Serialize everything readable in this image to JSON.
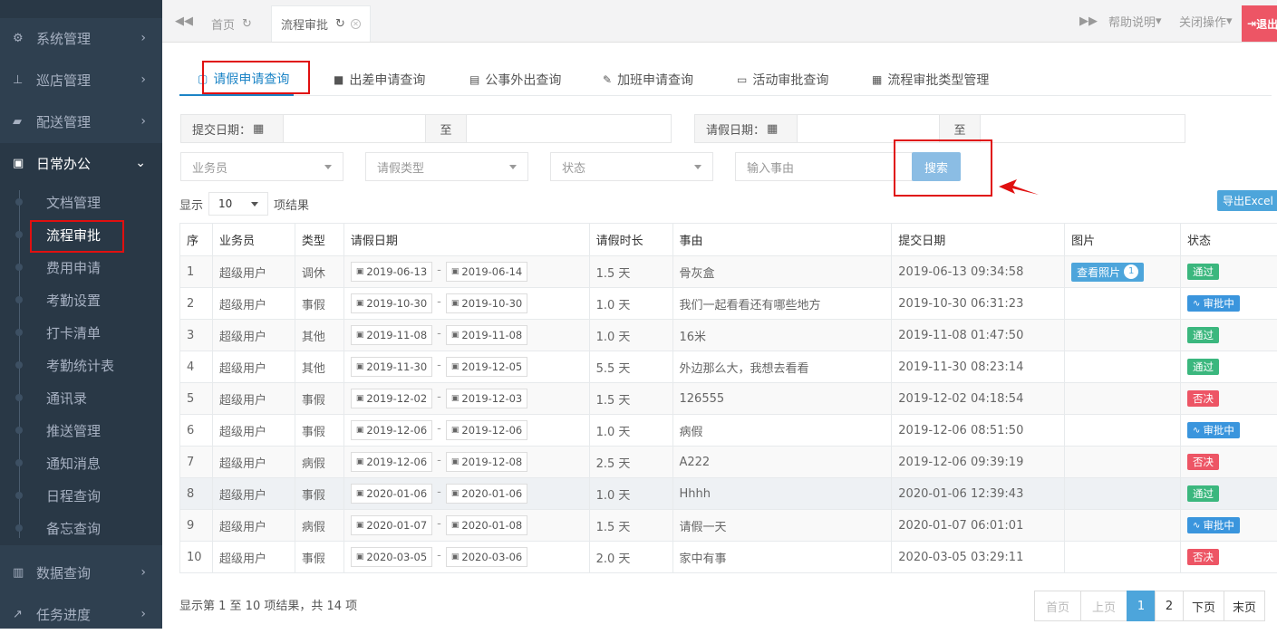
{
  "sidebar": {
    "menus": [
      {
        "label": "系统管理",
        "icon": "gears-icon"
      },
      {
        "label": "巡店管理",
        "icon": "sitemap-icon"
      },
      {
        "label": "配送管理",
        "icon": "truck-icon"
      },
      {
        "label": "日常办公",
        "icon": "briefcase-icon"
      },
      {
        "label": "数据查询",
        "icon": "bar-chart-icon"
      },
      {
        "label": "任务进度",
        "icon": "line-chart-icon"
      }
    ],
    "subitems": [
      "文档管理",
      "流程审批",
      "费用申请",
      "考勤设置",
      "打卡清单",
      "考勤统计表",
      "通讯录",
      "推送管理",
      "通知消息",
      "日程查询",
      "备忘查询"
    ]
  },
  "topbar": {
    "tabs": [
      "首页",
      "流程审批"
    ],
    "help": "帮助说明",
    "close_ops": "关闭操作",
    "logout": "退出"
  },
  "content_tabs": [
    "请假申请查询",
    "出差申请查询",
    "公事外出查询",
    "加班申请查询",
    "活动审批查询",
    "流程审批类型管理"
  ],
  "filters": {
    "submit_date_label": "提交日期：",
    "leave_date_label": "请假日期：",
    "to": "至",
    "salesman_placeholder": "业务员",
    "leave_type_placeholder": "请假类型",
    "status_placeholder": "状态",
    "reason_placeholder": "输入事由",
    "search": "搜索"
  },
  "listing": {
    "show": "显示",
    "page_size": "10",
    "items_suffix": "项结果",
    "export": "导出Excel"
  },
  "table": {
    "headers": [
      "序",
      "业务员",
      "类型",
      "请假日期",
      "请假时长",
      "事由",
      "提交日期",
      "图片",
      "状态"
    ],
    "photo_label": "查看照片",
    "rows": [
      {
        "no": "1",
        "user": "超级用户",
        "type": "调休",
        "start": "2019-06-13",
        "end": "2019-06-14",
        "duration": "1.5 天",
        "reason": "骨灰盒",
        "submitted": "2019-06-13 09:34:58",
        "photos": "1",
        "status": "通过",
        "status_kind": "ok"
      },
      {
        "no": "2",
        "user": "超级用户",
        "type": "事假",
        "start": "2019-10-30",
        "end": "2019-10-30",
        "duration": "1.0 天",
        "reason": "我们一起看看还有哪些地方",
        "submitted": "2019-10-30 06:31:23",
        "photos": "",
        "status": "审批中",
        "status_kind": "wait"
      },
      {
        "no": "3",
        "user": "超级用户",
        "type": "其他",
        "start": "2019-11-08",
        "end": "2019-11-08",
        "duration": "1.0 天",
        "reason": "16米",
        "submitted": "2019-11-08 01:47:50",
        "photos": "",
        "status": "通过",
        "status_kind": "ok"
      },
      {
        "no": "4",
        "user": "超级用户",
        "type": "其他",
        "start": "2019-11-30",
        "end": "2019-12-05",
        "duration": "5.5 天",
        "reason": "外边那么大，我想去看看",
        "submitted": "2019-11-30 08:23:14",
        "photos": "",
        "status": "通过",
        "status_kind": "ok"
      },
      {
        "no": "5",
        "user": "超级用户",
        "type": "事假",
        "start": "2019-12-02",
        "end": "2019-12-03",
        "duration": "1.5 天",
        "reason": "126555",
        "submitted": "2019-12-02 04:18:54",
        "photos": "",
        "status": "否决",
        "status_kind": "no"
      },
      {
        "no": "6",
        "user": "超级用户",
        "type": "事假",
        "start": "2019-12-06",
        "end": "2019-12-06",
        "duration": "1.0 天",
        "reason": "病假",
        "submitted": "2019-12-06 08:51:50",
        "photos": "",
        "status": "审批中",
        "status_kind": "wait"
      },
      {
        "no": "7",
        "user": "超级用户",
        "type": "病假",
        "start": "2019-12-06",
        "end": "2019-12-08",
        "duration": "2.5 天",
        "reason": "A222",
        "submitted": "2019-12-06 09:39:19",
        "photos": "",
        "status": "否决",
        "status_kind": "no"
      },
      {
        "no": "8",
        "user": "超级用户",
        "type": "事假",
        "start": "2020-01-06",
        "end": "2020-01-06",
        "duration": "1.0 天",
        "reason": "Hhhh",
        "submitted": "2020-01-06 12:39:43",
        "photos": "",
        "status": "通过",
        "status_kind": "ok"
      },
      {
        "no": "9",
        "user": "超级用户",
        "type": "病假",
        "start": "2020-01-07",
        "end": "2020-01-08",
        "duration": "1.5 天",
        "reason": "请假一天",
        "submitted": "2020-01-07 06:01:01",
        "photos": "",
        "status": "审批中",
        "status_kind": "wait"
      },
      {
        "no": "10",
        "user": "超级用户",
        "type": "事假",
        "start": "2020-03-05",
        "end": "2020-03-06",
        "duration": "2.0 天",
        "reason": "家中有事",
        "submitted": "2020-03-05 03:29:11",
        "photos": "",
        "status": "否决",
        "status_kind": "no"
      }
    ]
  },
  "footer": {
    "info": "显示第 1 至 10 项结果，共 14 项",
    "pager": [
      "首页",
      "上页",
      "1",
      "2",
      "下页",
      "末页"
    ],
    "current_page": "1"
  },
  "colors": {
    "sidebar_bg": "#2f4050",
    "accent": "#1c84c6",
    "approved": "#3bb77e",
    "rejected": "#ed5565",
    "pending": "#3a95dd",
    "highlight_box": "#e01010"
  }
}
